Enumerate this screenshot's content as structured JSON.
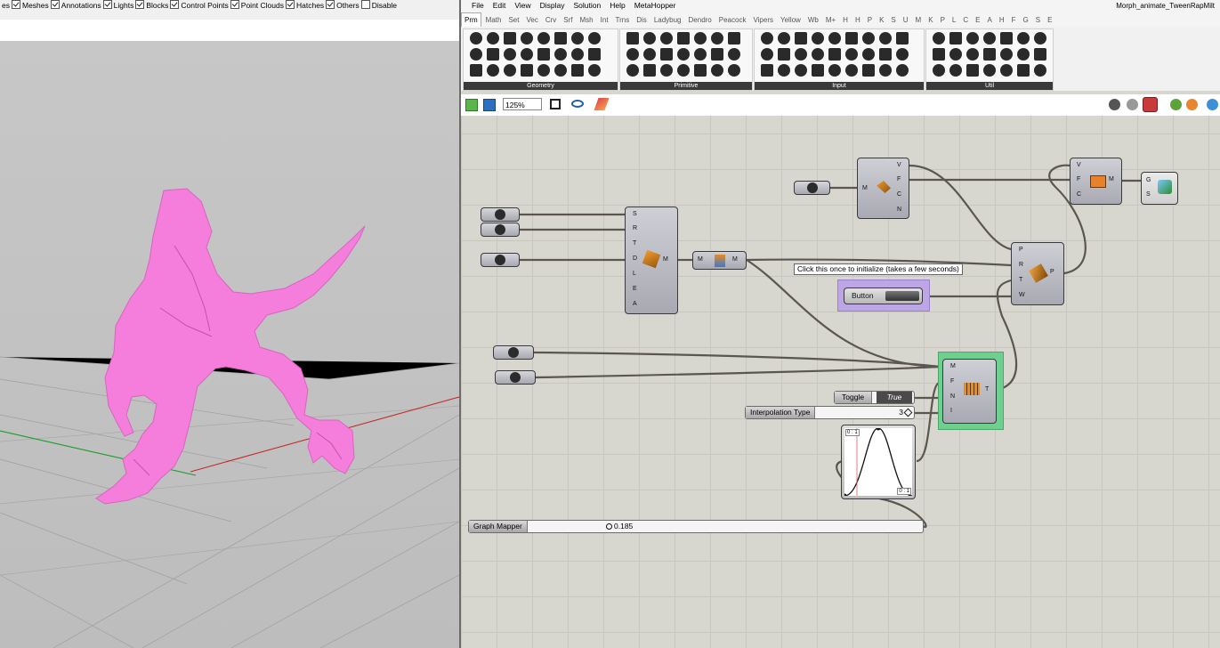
{
  "rhino": {
    "filters": [
      {
        "label": "es",
        "checked": false,
        "show_box": false
      },
      {
        "label": "Meshes",
        "checked": true,
        "show_box": true
      },
      {
        "label": "Annotations",
        "checked": true,
        "show_box": true
      },
      {
        "label": "Lights",
        "checked": true,
        "show_box": true
      },
      {
        "label": "Blocks",
        "checked": true,
        "show_box": true
      },
      {
        "label": "Control Points",
        "checked": true,
        "show_box": true
      },
      {
        "label": "Point Clouds",
        "checked": true,
        "show_box": true
      },
      {
        "label": "Hatches",
        "checked": true,
        "show_box": true
      },
      {
        "label": "Others",
        "checked": true,
        "show_box": true
      },
      {
        "label": "Disable",
        "checked": false,
        "show_box": true
      }
    ],
    "model_color": "#f57ddb"
  },
  "gh": {
    "title": "Morph_animate_TweenRapMilt",
    "menu": [
      "File",
      "Edit",
      "View",
      "Display",
      "Solution",
      "Help",
      "MetaHopper"
    ],
    "tabs": [
      "Prm",
      "Math",
      "Set",
      "Vec",
      "Crv",
      "Srf",
      "Msh",
      "Int",
      "Trns",
      "Dis",
      "Ladybug",
      "Dendro",
      "Peacock",
      "Vipers",
      "Yellow",
      "Wb",
      "M+",
      "H",
      "H",
      "P",
      "K",
      "S",
      "U",
      "M",
      "K",
      "P",
      "L",
      "C",
      "E",
      "A",
      "H",
      "F",
      "G",
      "S",
      "E"
    ],
    "ribbon_groups": [
      "Geometry",
      "Primitive",
      "Input",
      "Util"
    ],
    "zoom": "125%",
    "tooltip": "Click this once to initialize (takes a few seconds)",
    "button_label": "Button",
    "toggle_label": "Toggle",
    "toggle_value": "True",
    "interp_label": "Interpolation Type",
    "interp_value": "3",
    "graph_label": "Graph Mapper",
    "graph_value": "0.185",
    "graph_range": "0 : 1",
    "ports": {
      "morph_in": [
        "S",
        "R",
        "T",
        "D",
        "L",
        "E",
        "A"
      ],
      "morph_out": "M",
      "mesh_in": "M",
      "mesh_out": "M",
      "bake_in": [
        "V",
        "F",
        "C",
        "N"
      ],
      "bake_left": "M",
      "mesh_from": [
        "V",
        "F",
        "C"
      ],
      "mesh_from_out": "M",
      "pnode_in": [
        "P",
        "R",
        "T",
        "W"
      ],
      "pnode_out": "P",
      "tween_in": [
        "M",
        "F",
        "N",
        "I"
      ],
      "tween_out": "T",
      "preview": [
        "G",
        "S"
      ]
    },
    "colors": {
      "button_group": "#bca6e6",
      "tween_group": "#6fcf8f",
      "wire": "#5c5650"
    }
  }
}
